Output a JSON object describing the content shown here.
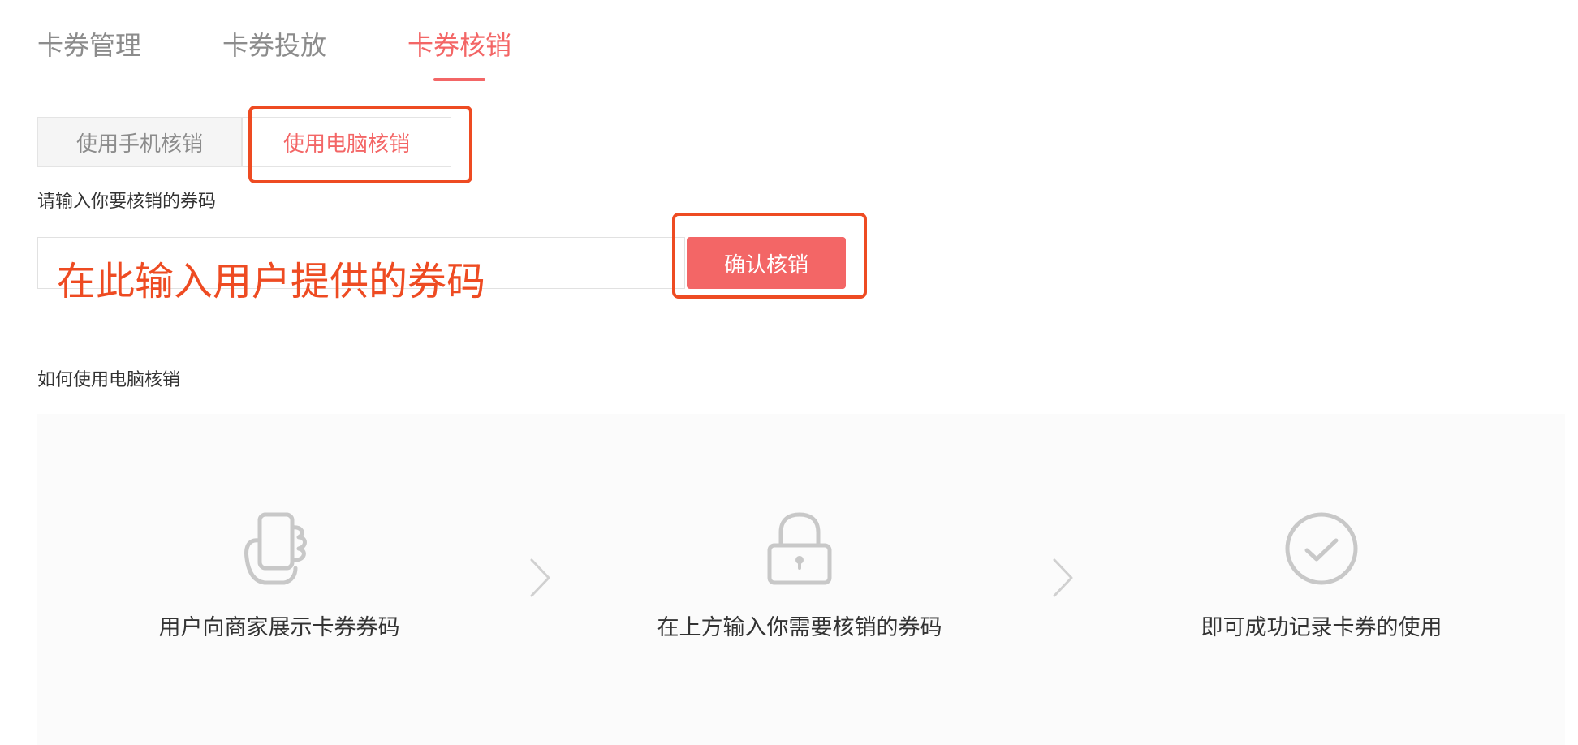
{
  "tabs": [
    {
      "label": "卡券管理"
    },
    {
      "label": "卡券投放"
    },
    {
      "label": "卡券核销"
    }
  ],
  "sub_tabs": [
    {
      "label": "使用手机核销"
    },
    {
      "label": "使用电脑核销"
    }
  ],
  "form": {
    "label": "请输入你要核销的券码",
    "input_value": "",
    "confirm_label": "确认核销"
  },
  "annotation": {
    "input_hint": "在此输入用户提供的券码",
    "color": "#ee4b22"
  },
  "guide": {
    "title": "如何使用电脑核销",
    "steps": [
      {
        "icon": "hand-phone-icon",
        "text": "用户向商家展示卡券券码"
      },
      {
        "icon": "lock-icon",
        "text": "在上方输入你需要核销的券码"
      },
      {
        "icon": "check-circle-icon",
        "text": "即可成功记录卡券的使用"
      }
    ]
  },
  "colors": {
    "accent": "#f36666",
    "annotation": "#ee4b22",
    "muted_text": "#8c8c8c"
  }
}
